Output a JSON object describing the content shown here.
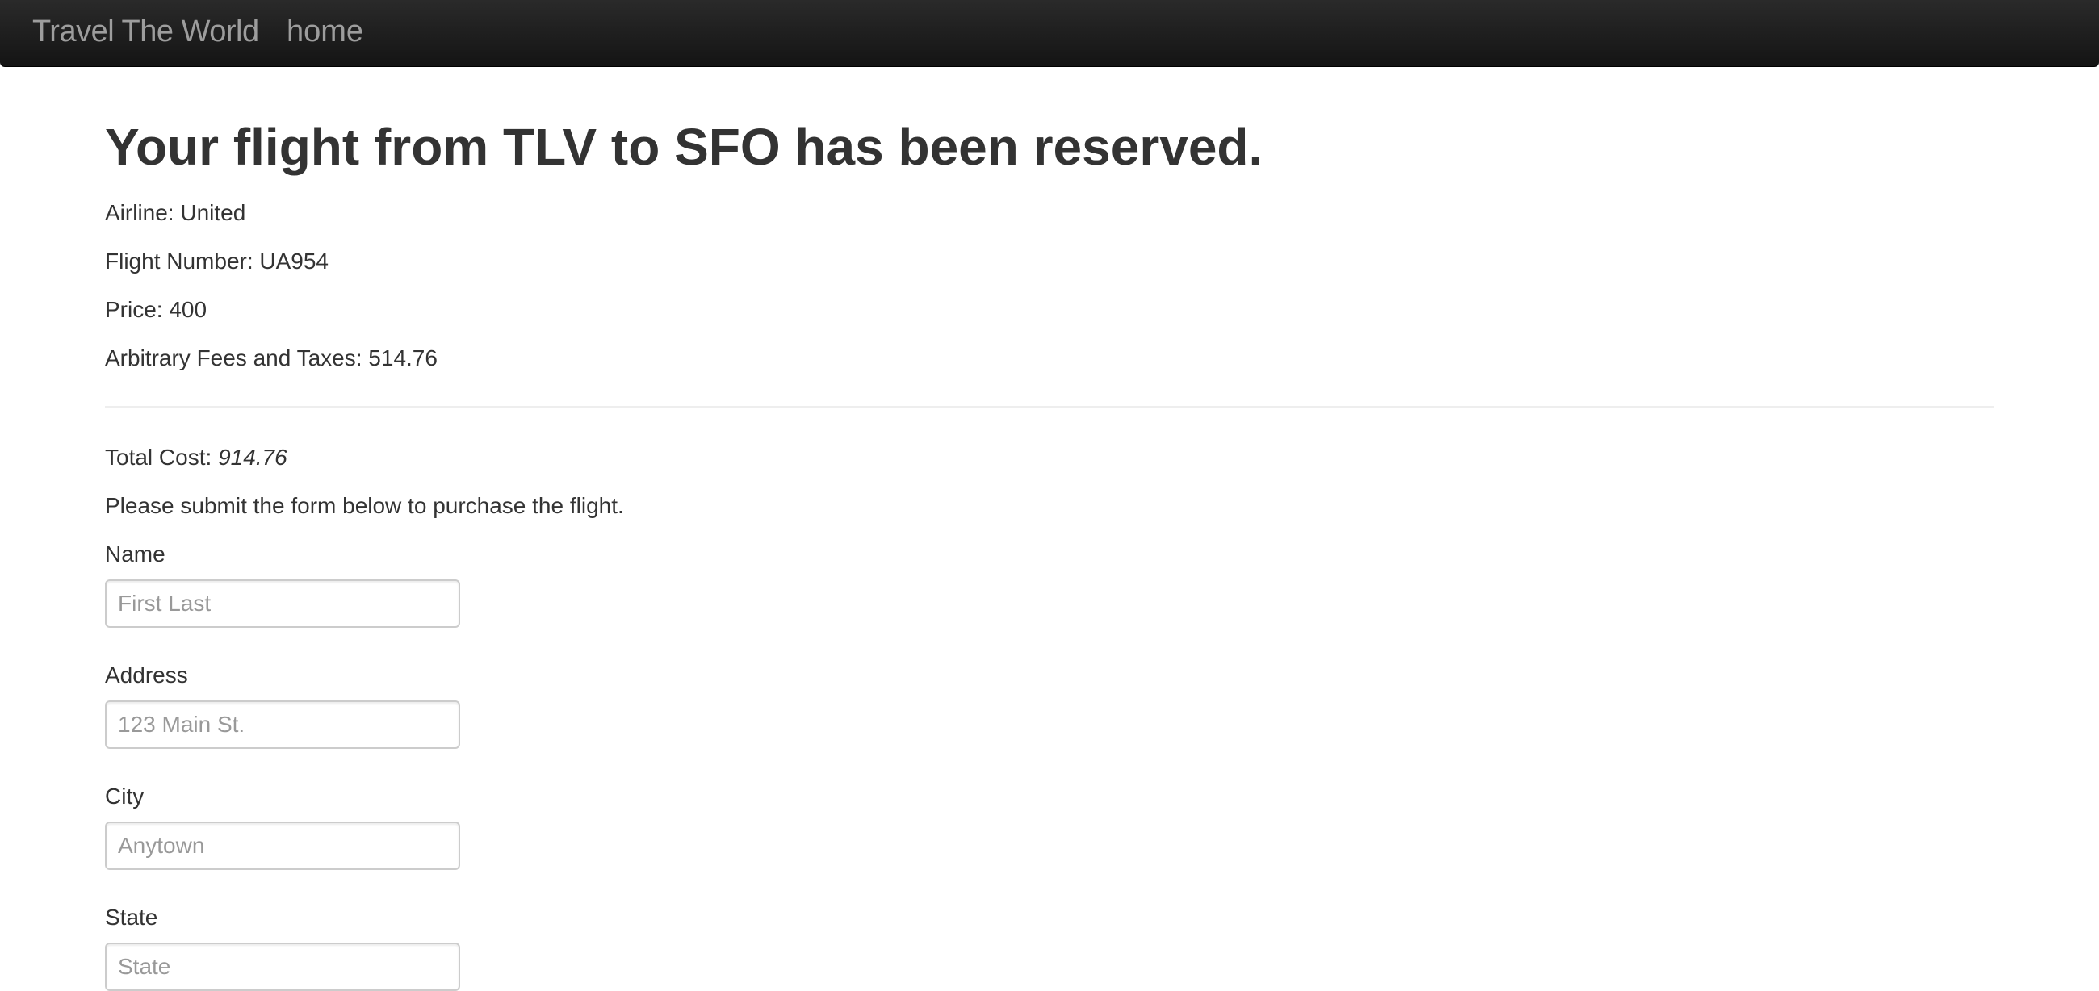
{
  "navbar": {
    "brand": "Travel The World",
    "home_link": "home"
  },
  "confirmation": {
    "heading": "Your flight from TLV to SFO has been reserved.",
    "airline": "Airline: United",
    "flight_number": "Flight Number: UA954",
    "price": "Price: 400",
    "fees": "Arbitrary Fees and Taxes: 514.76",
    "total_label": "Total Cost:",
    "total_value": "914.76",
    "instruction": "Please submit the form below to purchase the flight."
  },
  "form": {
    "name": {
      "label": "Name",
      "placeholder": "First Last",
      "value": ""
    },
    "address": {
      "label": "Address",
      "placeholder": "123 Main St.",
      "value": ""
    },
    "city": {
      "label": "City",
      "placeholder": "Anytown",
      "value": ""
    },
    "state": {
      "label": "State",
      "placeholder": "State",
      "value": ""
    }
  }
}
